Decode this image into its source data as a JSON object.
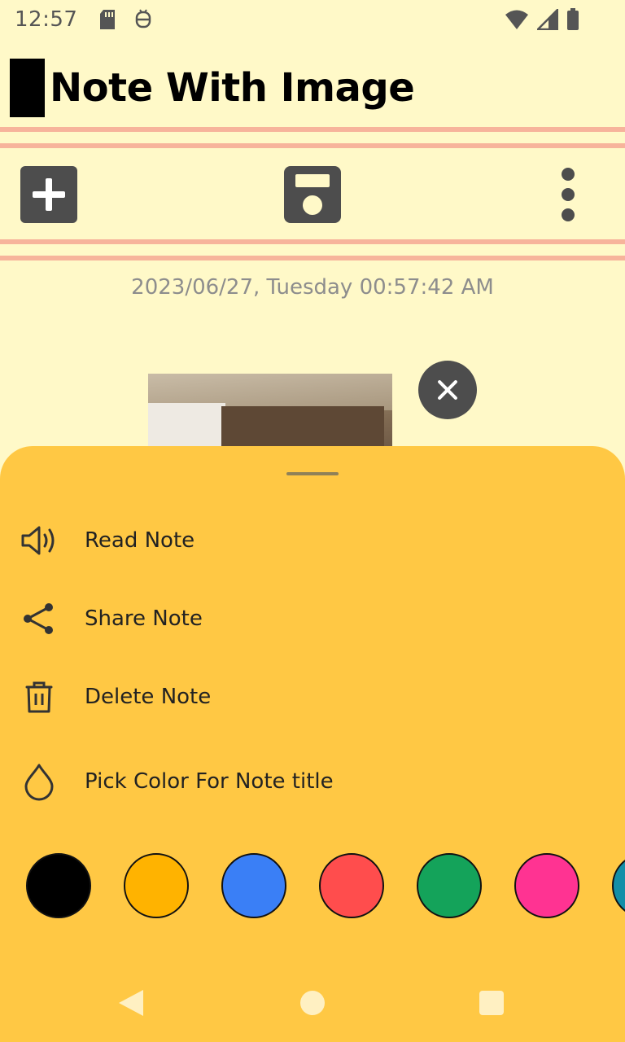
{
  "status_bar": {
    "time": "12:57",
    "left_icons": [
      "sd-card-icon",
      "app-notification-icon"
    ],
    "right_icons": [
      "wifi-icon",
      "signal-icon",
      "battery-icon"
    ]
  },
  "note": {
    "title": "Note With Image",
    "timestamp": "2023/06/27, Tuesday 00:57:42 AM"
  },
  "toolbar": {
    "icons": [
      "add-icon",
      "save-icon",
      "more-vert-icon"
    ]
  },
  "menu": {
    "items": [
      {
        "label": "Read Note",
        "icon": "speaker-icon"
      },
      {
        "label": "Share Note",
        "icon": "share-icon"
      },
      {
        "label": "Delete Note",
        "icon": "trash-icon"
      },
      {
        "label": "Pick Color For Note title",
        "icon": "droplet-icon"
      }
    ]
  },
  "colors": {
    "background": "#fff9c8",
    "sheet": "#ffc844",
    "rule": "#f7b49b",
    "swatches": [
      "#000000",
      "#ffb300",
      "#3a7ff6",
      "#ff4d4d",
      "#14a35a",
      "#ff3392",
      "#138fa8"
    ]
  },
  "nav_bar": {
    "icons": [
      "back-icon",
      "home-icon",
      "recents-icon"
    ]
  }
}
